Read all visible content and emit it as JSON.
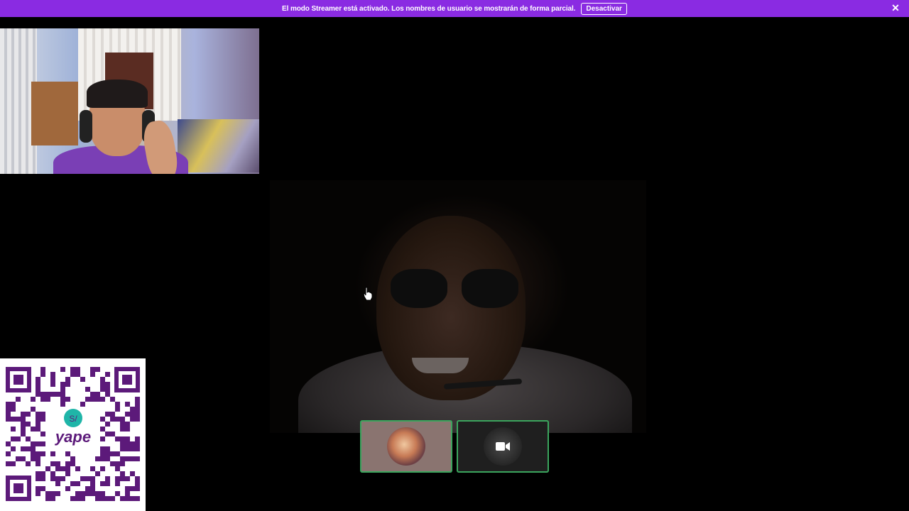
{
  "banner": {
    "message": "El modo Streamer está activado. Los nombres de usuario se mostrarán de forma parcial.",
    "button_label": "Desactivar",
    "close_label": "✕",
    "background": "#8a2be2"
  },
  "call": {
    "main_video_icon": "video-feed",
    "pip_icon": "webcam-feed",
    "qr_brand": "yape",
    "qr_currency": "S/",
    "tiles": [
      {
        "name": "participant-tile-1",
        "icon": "avatar",
        "active_border": "#3ba55d"
      },
      {
        "name": "participant-tile-2",
        "icon": "video-camera-icon",
        "active_border": "#3ba55d"
      }
    ]
  }
}
